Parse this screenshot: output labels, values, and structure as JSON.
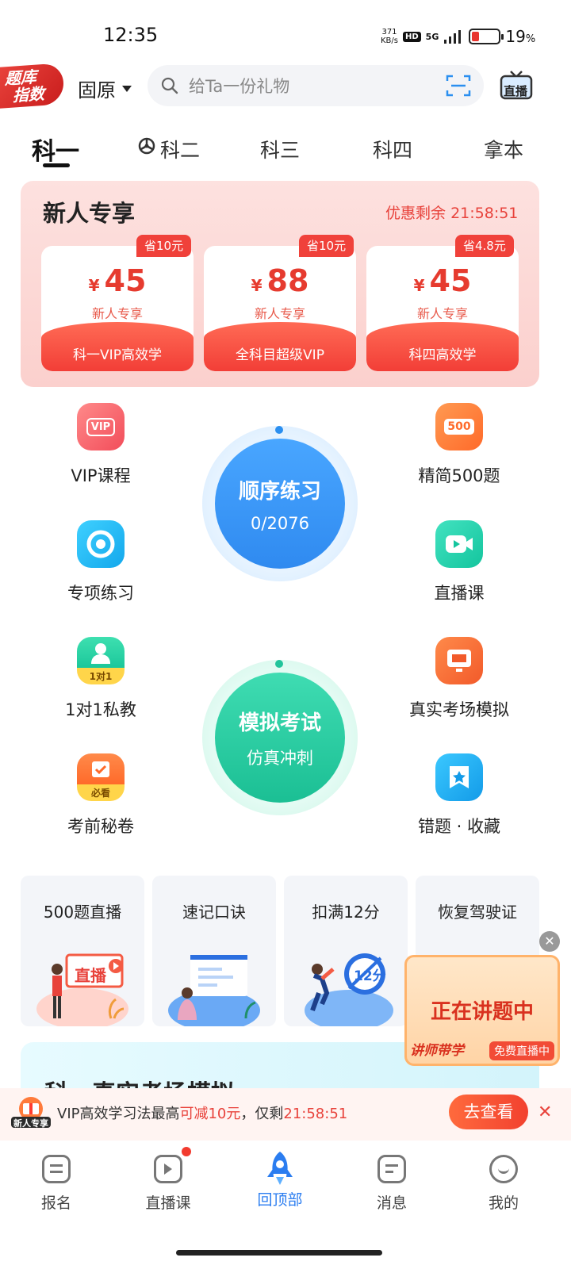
{
  "status_bar": {
    "time": "12:35",
    "speed_value": "371",
    "speed_unit": "KB/s",
    "hd": "HD",
    "network": "5G",
    "battery_percent": "19",
    "battery_pct_symbol": "%"
  },
  "header": {
    "logo_line1": "题库",
    "logo_line2": "指数",
    "city": "固原",
    "search_placeholder": "给Ta一份礼物",
    "live_label": "直播"
  },
  "tabs": [
    {
      "label": "科一",
      "active": true
    },
    {
      "label": "科二",
      "active": false
    },
    {
      "label": "科三",
      "active": false
    },
    {
      "label": "科四",
      "active": false
    },
    {
      "label": "拿本",
      "active": false
    }
  ],
  "new_user": {
    "title": "新人专享",
    "countdown_label": "优惠剩余",
    "countdown": "21:58:51",
    "currency": "¥",
    "coupons": [
      {
        "price": "45",
        "sub": "新人专享",
        "name": "科一VIP高效学",
        "save": "省10元"
      },
      {
        "price": "88",
        "sub": "新人专享",
        "name": "全科目超级VIP",
        "save": "省10元"
      },
      {
        "price": "45",
        "sub": "新人专享",
        "name": "科四高效学",
        "save": "省4.8元"
      }
    ]
  },
  "grid": {
    "vip": "VIP课程",
    "vip_icon_text": "VIP",
    "jingjian": "精简500题",
    "jingjian_icon_text": "500",
    "zhuanxiang": "专项练习",
    "zhibo": "直播课",
    "private": "1对1私教",
    "private_icon_text": "1对1",
    "real_exam": "真实考场模拟",
    "secret": "考前秘卷",
    "secret_icon_text": "必看",
    "wrong": "错题 · 收藏"
  },
  "practice": {
    "title": "顺序练习",
    "progress": "0/2076"
  },
  "mock": {
    "title": "模拟考试",
    "sub": "仿真冲刺"
  },
  "features": [
    {
      "title": "500题直播",
      "art_text": "直播"
    },
    {
      "title": "速记口诀"
    },
    {
      "title": "扣满12分",
      "art_text": "12分"
    },
    {
      "title": "恢复驾驶证"
    }
  ],
  "float_live": {
    "title": "正在讲题中",
    "left_tag": "讲师带学",
    "right_tag": "免费直播中"
  },
  "next_section_title": "科一真实考场模拟",
  "promo": {
    "badge": "新人专享",
    "text_prefix": "VIP高效学习法最高",
    "text_highlight": "可减10元",
    "text_mid": "，仅剩",
    "text_time": "21:58:51",
    "button": "去查看"
  },
  "bottom_nav": [
    {
      "label": "报名"
    },
    {
      "label": "直播课"
    },
    {
      "label": "回顶部",
      "active": true
    },
    {
      "label": "消息"
    },
    {
      "label": "我的"
    }
  ],
  "colors": {
    "accent_red": "#e8423b",
    "accent_blue": "#2b7df0",
    "mock_green": "#2fc7a0"
  }
}
